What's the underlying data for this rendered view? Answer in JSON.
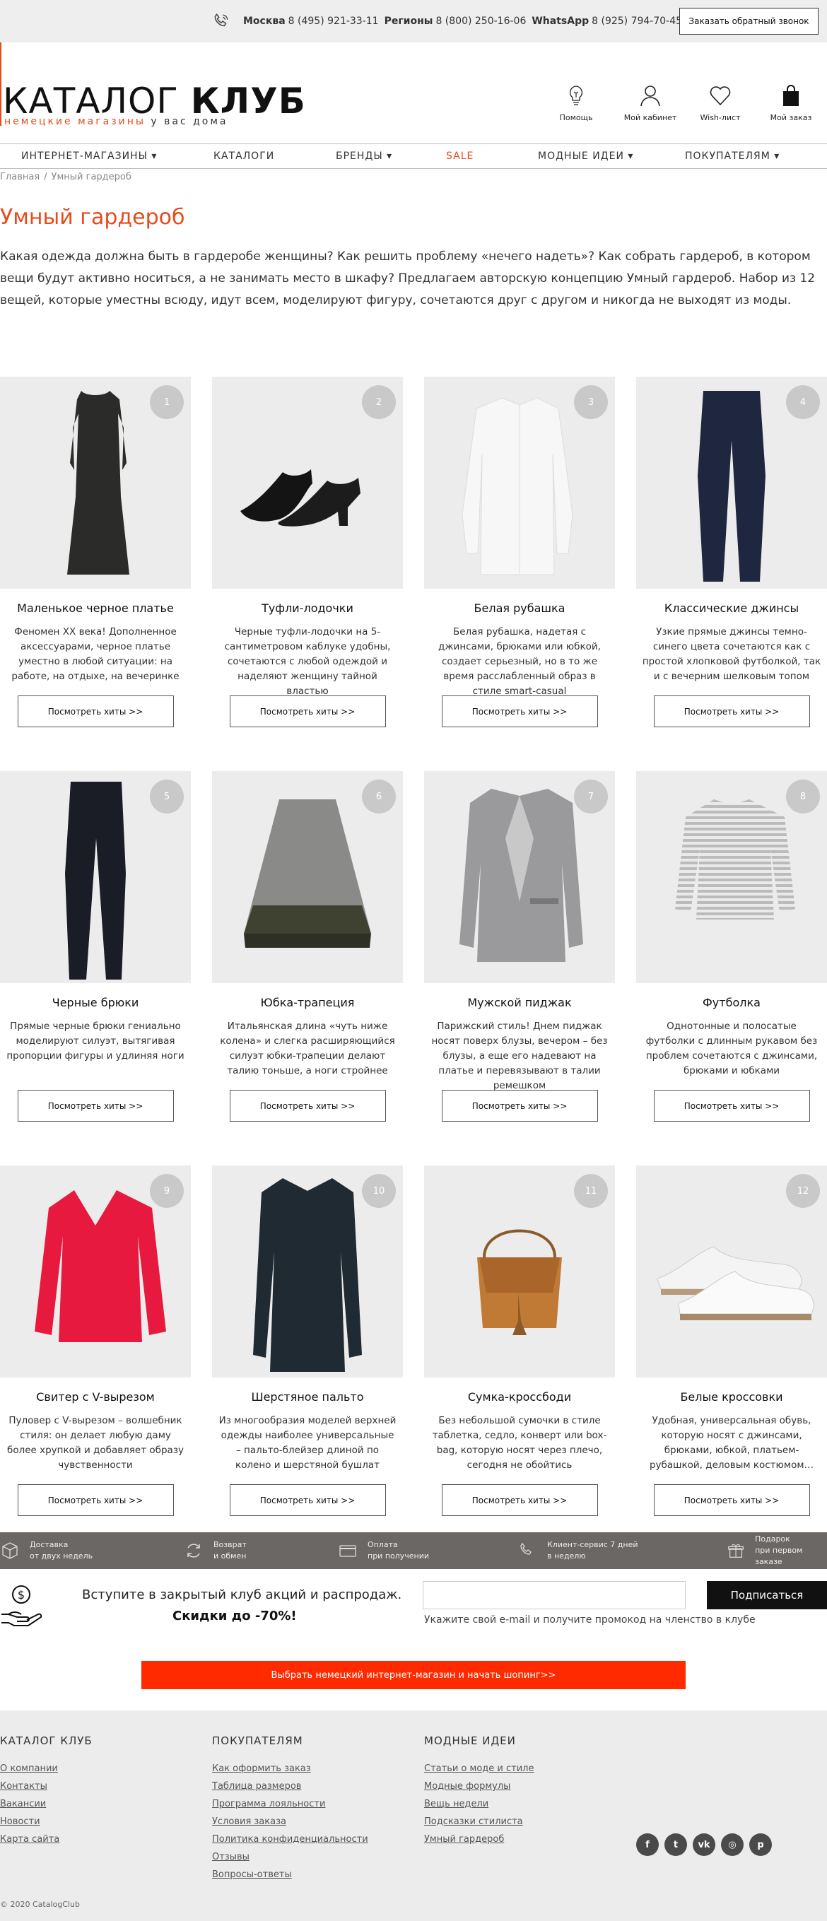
{
  "topbar": {
    "moscow_label": "Москва",
    "moscow_phone": "8 (495) 921-33-11",
    "regions_label": "Регионы",
    "regions_phone": "8 (800) 250-16-06",
    "whatsapp_label": "WhatsApp",
    "whatsapp_phone": "8 (925) 794-70-45",
    "callback_label": "Заказать обратный звонок"
  },
  "logo": {
    "thin": "КАТАЛОГ ",
    "bold": "КЛУБ",
    "tag_accent": "немецкие магазины",
    "tag_rest": " у вас дома"
  },
  "header_icons": [
    {
      "label": "Помощь",
      "icon": "lightbulb-icon"
    },
    {
      "label": "Мой кабинет",
      "icon": "user-icon"
    },
    {
      "label": "Wish-лист",
      "icon": "heart-icon"
    },
    {
      "label": "Мой заказ",
      "icon": "bag-icon"
    }
  ],
  "nav": [
    {
      "label": "ИНТЕРНЕТ-МАГАЗИНЫ ▾"
    },
    {
      "label": "КАТАЛОГИ"
    },
    {
      "label": "БРЕНДЫ ▾"
    },
    {
      "label": "SALE"
    },
    {
      "label": "МОДНЫЕ ИДЕИ ▾"
    },
    {
      "label": "ПОКУПАТЕЛЯМ ▾"
    }
  ],
  "breadcrumb": {
    "home": "Главная",
    "sep": "/",
    "current": "Умный гардероб"
  },
  "page": {
    "title": "Умный гардероб",
    "intro": "Какая одежда должна быть в гардеробе женщины? Как решить проблему «нечего надеть»? Как собрать гардероб, в котором вещи будут активно носиться, а не занимать место в шкафу? Предлагаем авторскую концепцию Умный гардероб. Набор из 12 вещей, которые уместны всюду, идут всем, моделируют фигуру, сочетаются друг с другом и никогда не выходят из моды."
  },
  "products": [
    {
      "num": "1",
      "name": "Маленькое черное платье",
      "desc": "Феномен XX века! Дополненное аксессуарами, черное платье уместно в любой ситуации: на работе, на отдыхе, на вечеринке",
      "button": "Посмотреть хиты >>",
      "icon": "dress-icon"
    },
    {
      "num": "2",
      "name": "Туфли-лодочки",
      "desc": "Черные туфли-лодочки на 5-сантиметровом каблуке удобны, сочетаются с любой одеждой и наделяют женщину тайной властью",
      "button": "Посмотреть хиты >>",
      "icon": "pumps-icon"
    },
    {
      "num": "3",
      "name": "Белая рубашка",
      "desc": "Белая рубашка, надетая с джинсами, брюками или юбкой, создает серьезный, но в то же время расслабленный образ в стиле smart-casual",
      "button": "Посмотреть хиты >>",
      "icon": "shirt-icon"
    },
    {
      "num": "4",
      "name": "Классические джинсы",
      "desc": "Узкие прямые джинсы темно-синего цвета сочетаются как с простой хлопковой футболкой, так и с вечерним шелковым топом",
      "button": "Посмотреть хиты >>",
      "icon": "jeans-icon"
    },
    {
      "num": "5",
      "name": "Черные брюки",
      "desc": "Прямые черные брюки гениально моделируют силуэт, вытягивая пропорции фигуры и удлиняя ноги",
      "button": "Посмотреть хиты >>",
      "icon": "trousers-icon"
    },
    {
      "num": "6",
      "name": "Юбка-трапеция",
      "desc": "Итальянская длина «чуть ниже колена» и слегка расширяющийся силуэт юбки-трапеции делают талию тоньше, а ноги стройнее",
      "button": "Посмотреть хиты >>",
      "icon": "skirt-icon"
    },
    {
      "num": "7",
      "name": "Мужской пиджак",
      "desc": "Парижский стиль! Днем пиджак носят поверх блузы, вечером – без блузы, а еще его надевают на платье и перевязывают в талии ремешком",
      "button": "Посмотреть хиты >>",
      "icon": "blazer-icon"
    },
    {
      "num": "8",
      "name": "Футболка",
      "desc": "Однотонные и полосатые футболки с длинным рукавом без проблем сочетаются с джинсами, брюками и юбками",
      "button": "Посмотреть хиты >>",
      "icon": "tshirt-icon"
    },
    {
      "num": "9",
      "name": "Свитер с V-вырезом",
      "desc": "Пуловер с V-вырезом – волшебник стиля: он делает любую даму более хрупкой и добавляет образу чувственности",
      "button": "Посмотреть хиты >>",
      "icon": "sweater-icon"
    },
    {
      "num": "10",
      "name": "Шерстяное пальто",
      "desc": "Из многообразия моделей верхней одежды наиболее универсальные – пальто-блейзер длиной по колено и шерстяной бушлат",
      "button": "Посмотреть хиты >>",
      "icon": "coat-icon"
    },
    {
      "num": "11",
      "name": "Сумка-кроссбоди",
      "desc": "Без небольшой сумочки в стиле таблетка, седло, конверт или box-bag, которую носят через плечо, сегодня не обойтись",
      "button": "Посмотреть хиты >>",
      "icon": "crossbody-bag-icon"
    },
    {
      "num": "12",
      "name": "Белые кроссовки",
      "desc": "Удобная, универсальная обувь, которую носят с джинсами, брюками, юбкой, платьем-рубашкой, деловым костюмом…",
      "button": "Посмотреть хиты >>",
      "icon": "sneakers-icon"
    }
  ],
  "features": [
    {
      "line1": "Доставка",
      "line2": "от двух недель",
      "icon": "box-icon"
    },
    {
      "line1": "Возврат",
      "line2": "и обмен",
      "icon": "return-icon"
    },
    {
      "line1": "Оплата",
      "line2": "при получении",
      "icon": "card-icon"
    },
    {
      "line1": "Клиент-сервис 7 дней",
      "line2": "в неделю",
      "icon": "phone-icon"
    },
    {
      "line1": "Подарок",
      "line2": "при первом заказе",
      "icon": "gift-icon"
    }
  ],
  "subscribe": {
    "line1": "Вступите в закрытый клуб акций и распродаж.",
    "line2": "Скидки до -70%!",
    "email_placeholder": "",
    "button": "Подписаться",
    "hint": "Укажите свой e-mail и получите промокод на членство в клубе"
  },
  "cta": "Выбрать немецкий интернет-магазин и начать шопинг>>",
  "footer": {
    "col1": {
      "title": "КАТАЛОГ КЛУБ",
      "links": [
        "О компании",
        "Контакты",
        "Вакансии",
        "Новости",
        "Карта сайта"
      ]
    },
    "col2": {
      "title": "ПОКУПАТЕЛЯМ",
      "links": [
        "Как оформить заказ",
        "Таблица размеров",
        "Программа лояльности",
        "Условия заказа",
        "Политика конфиденциальности",
        "Отзывы",
        "Вопросы-ответы"
      ]
    },
    "col3": {
      "title": "МОДНЫЕ ИДЕИ",
      "links": [
        "Статьи о моде и стиле",
        "Модные формулы",
        "Вещь недели",
        "Подсказки стилиста",
        "Умный гардероб"
      ]
    },
    "social": [
      {
        "glyph": "f",
        "icon": "facebook-icon"
      },
      {
        "glyph": "t",
        "icon": "twitter-icon"
      },
      {
        "glyph": "vk",
        "icon": "vk-icon"
      },
      {
        "glyph": "◎",
        "icon": "instagram-icon"
      },
      {
        "glyph": "p",
        "icon": "pinterest-icon"
      }
    ],
    "copyright": "© 2020 CatalogClub"
  },
  "colors": {
    "accent": "#e84a1a",
    "cta": "#ff2a00",
    "feature_bar": "#6b6764",
    "card_bg": "#ececec"
  }
}
